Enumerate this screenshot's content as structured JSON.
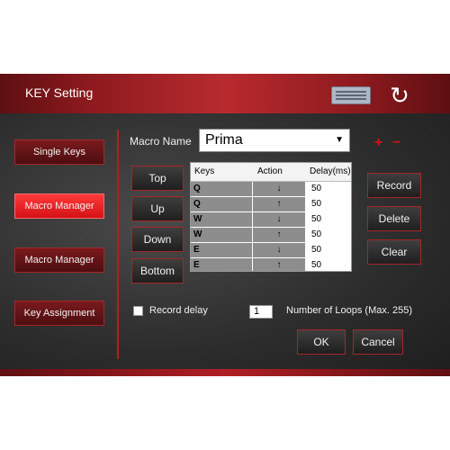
{
  "window": {
    "title": "KEY Setting"
  },
  "icons": {
    "keyboard": "keyboard-icon",
    "refresh": "refresh-icon",
    "plus": "+",
    "minus": "−"
  },
  "sidebar": {
    "items": [
      {
        "label": "Single Keys",
        "active": false
      },
      {
        "label": "Macro Manager",
        "active": true
      },
      {
        "label": "Macro Manager",
        "active": false
      },
      {
        "label": "Key Assignment",
        "active": false
      }
    ]
  },
  "macro": {
    "label": "Macro Name",
    "selected": "Prima"
  },
  "move_buttons": {
    "top": "Top",
    "up": "Up",
    "down": "Down",
    "bottom": "Bottom"
  },
  "table": {
    "headers": [
      "Keys",
      "Action",
      "Delay(ms)"
    ],
    "rows": [
      [
        "Q",
        "↓",
        "50"
      ],
      [
        "Q",
        "↑",
        "50"
      ],
      [
        "W",
        "↓",
        "50"
      ],
      [
        "W",
        "↑",
        "50"
      ],
      [
        "E",
        "↓",
        "50"
      ],
      [
        "E",
        "↑",
        "50"
      ],
      [
        "",
        "",
        ""
      ]
    ]
  },
  "right_buttons": {
    "record": "Record",
    "delete": "Delete",
    "clear": "Clear"
  },
  "options": {
    "record_delay": "Record delay",
    "loops_value": "1",
    "loops_label": "Number of Loops (Max. 255)"
  },
  "footer": {
    "ok": "OK",
    "cancel": "Cancel"
  },
  "colors": {
    "accent": "#d41116",
    "panel": "#2b2b2b"
  }
}
